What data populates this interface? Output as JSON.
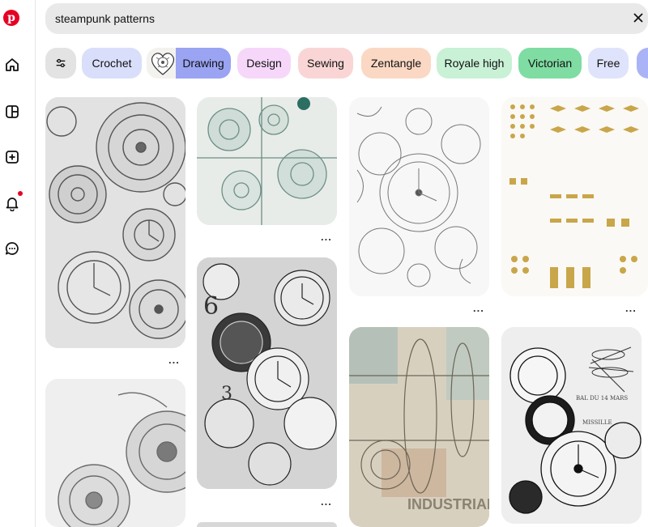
{
  "search": {
    "query": "steampunk patterns"
  },
  "chips": [
    {
      "label": "Crochet",
      "bg": "#d9defb"
    },
    {
      "label": "Drawing",
      "bg": "#9aa4f3"
    },
    {
      "label": "Design",
      "bg": "#f6d7fa"
    },
    {
      "label": "Sewing",
      "bg": "#fad5d5"
    },
    {
      "label": "Zentangle",
      "bg": "#fbd8c4"
    },
    {
      "label": "Royale high",
      "bg": "#c8f1d6"
    },
    {
      "label": "Victorian",
      "bg": "#7fdca2"
    },
    {
      "label": "Free",
      "bg": "#dfe3fb"
    }
  ],
  "sidebar_icons": [
    "pinterest-logo",
    "home-icon",
    "explore-icon",
    "create-icon",
    "notifications-icon",
    "messages-icon"
  ],
  "pins": [
    {
      "name": "pin-gears-clock-sketch",
      "more": "..."
    },
    {
      "name": "pin-teal-gears-blueprint",
      "more": "..."
    },
    {
      "name": "pin-clock-floral-lineart",
      "more": "..."
    },
    {
      "name": "pin-gold-ornaments-sheet",
      "more": "..."
    },
    {
      "name": "pin-pocket-watches-collage",
      "more": "..."
    },
    {
      "name": "pin-industrial-airship",
      "more": "..."
    },
    {
      "name": "pin-clock-dragonfly-collage",
      "more": "..."
    },
    {
      "name": "pin-gear-pencil-drawing",
      "more": "..."
    }
  ],
  "colors": {
    "brand": "#e60023",
    "search_bg": "#e9e9e9"
  }
}
